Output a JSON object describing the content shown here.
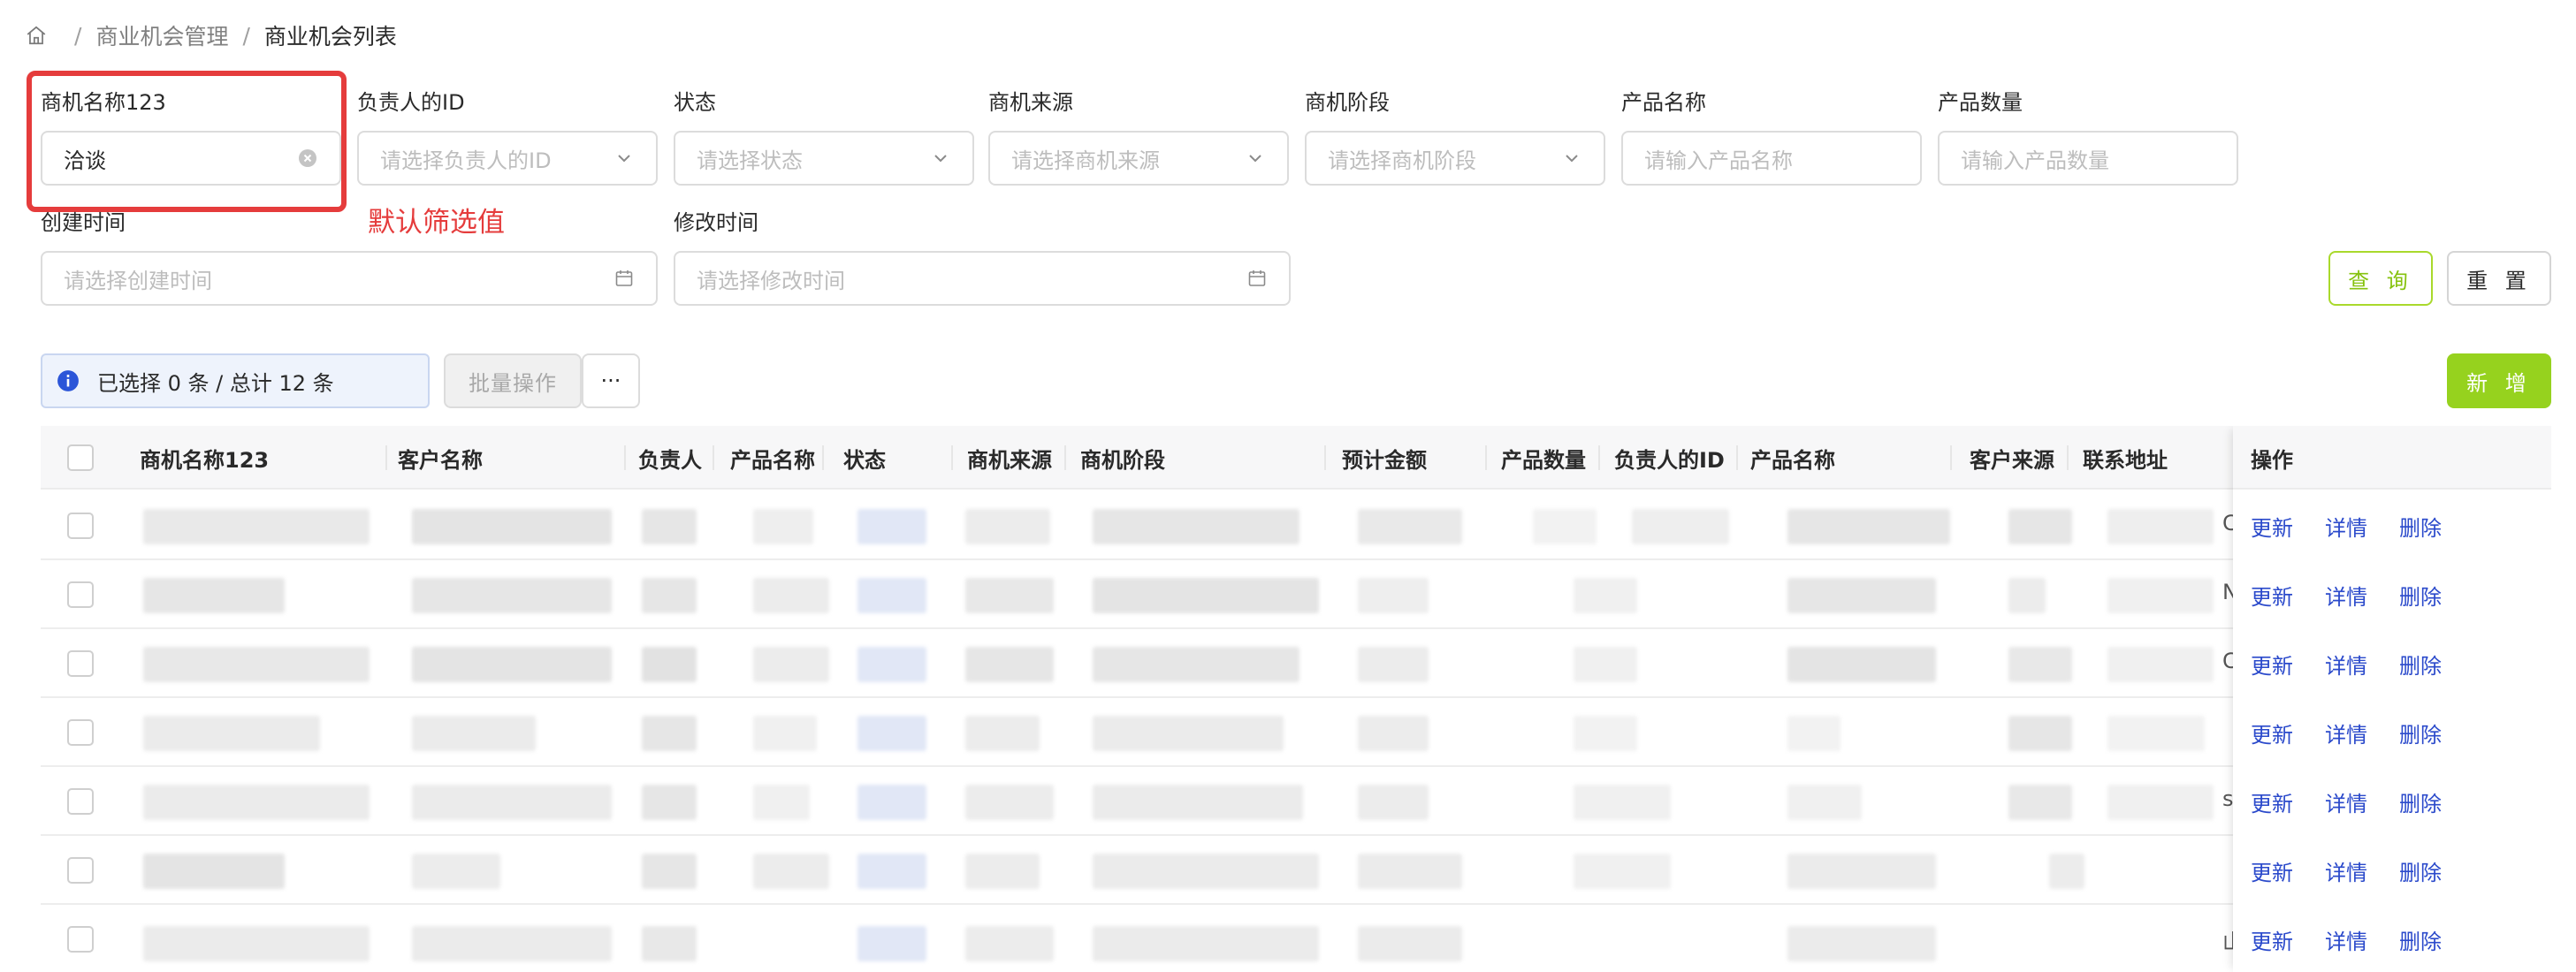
{
  "breadcrumb": {
    "items": [
      "商业机会管理",
      "商业机会列表"
    ],
    "separator": "/"
  },
  "filters": {
    "opp_name": {
      "label": "商机名称123",
      "value": "洽谈"
    },
    "owner_id": {
      "label": "负责人的ID",
      "placeholder": "请选择负责人的ID"
    },
    "status": {
      "label": "状态",
      "placeholder": "请选择状态"
    },
    "source": {
      "label": "商机来源",
      "placeholder": "请选择商机来源"
    },
    "stage": {
      "label": "商机阶段",
      "placeholder": "请选择商机阶段"
    },
    "product": {
      "label": "产品名称",
      "placeholder": "请输入产品名称"
    },
    "quantity": {
      "label": "产品数量",
      "placeholder": "请输入产品数量"
    },
    "created_at": {
      "label": "创建时间",
      "placeholder": "请选择创建时间"
    },
    "updated_at": {
      "label": "修改时间",
      "placeholder": "请选择修改时间"
    }
  },
  "annotation": {
    "text": "默认筛选值",
    "color": "#e53c3c"
  },
  "buttons": {
    "query": "查 询",
    "reset": "重 置",
    "new": "新 增",
    "batch": "批量操作",
    "more": "···"
  },
  "selection": {
    "text": "已选择 0 条 / 总计 12 条"
  },
  "table": {
    "headers": {
      "opp_name": "商机名称123",
      "customer": "客户名称",
      "owner": "负责人",
      "product": "产品名称",
      "status": "状态",
      "source": "商机来源",
      "stage": "商机阶段",
      "amount": "预计金额",
      "quantity": "产品数量",
      "owner_id": "负责人的ID",
      "product2": "产品名称",
      "cust_source": "客户来源",
      "address": "联系地址",
      "ops": "操作"
    },
    "row_actions": {
      "update": "更新",
      "detail": "详情",
      "delete": "删除"
    },
    "edge_glyphs": [
      "C",
      "N",
      "C",
      "",
      "s",
      "",
      "山"
    ]
  },
  "colors": {
    "accent_green": "#96d21e",
    "link_blue": "#2b4acb",
    "annotation_red": "#e53c3c"
  },
  "icons": {
    "home": "home-icon",
    "clear": "clear-icon",
    "chevron": "chevron-down-icon",
    "calendar": "calendar-icon",
    "info": "info-icon"
  }
}
